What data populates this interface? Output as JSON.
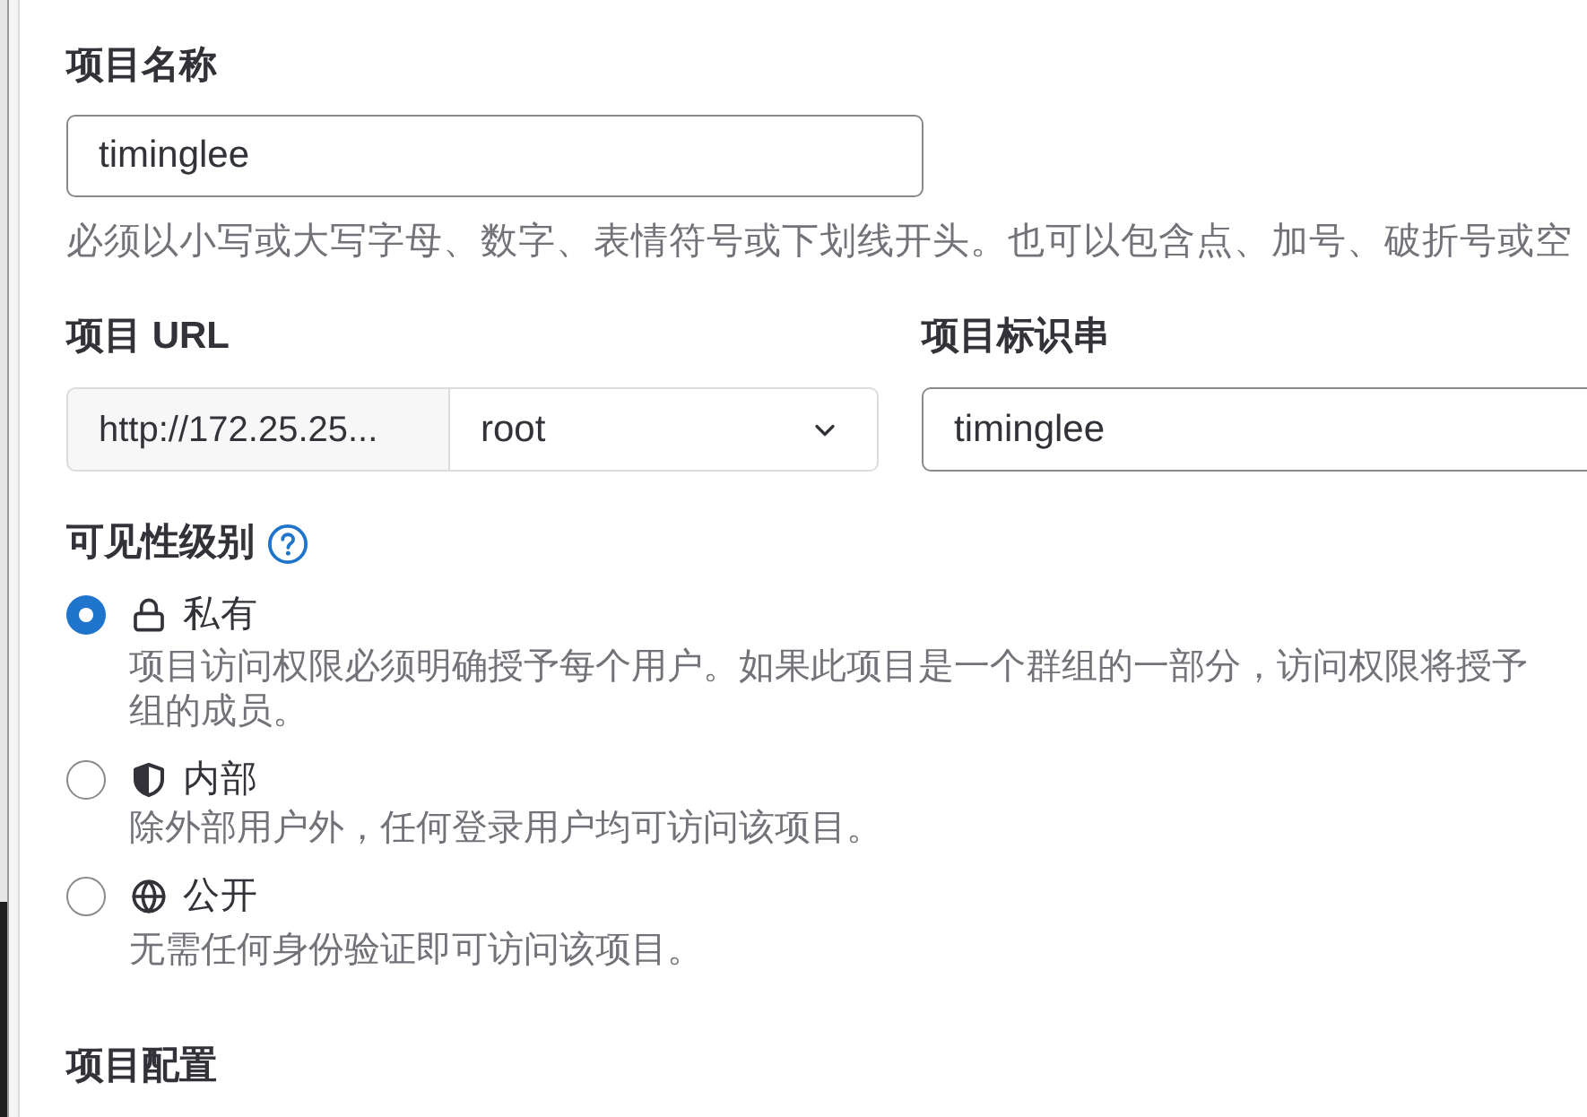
{
  "project_name": {
    "label": "项目名称",
    "value": "timinglee",
    "help": "必须以小写或大写字母、数字、表情符号或下划线开头。也可以包含点、加号、破折号或空"
  },
  "project_url": {
    "label": "项目 URL",
    "prefix": "http://172.25.25...",
    "namespace": "root"
  },
  "project_slug": {
    "label": "项目标识串",
    "value": "timinglee"
  },
  "visibility": {
    "label": "可见性级别",
    "options": [
      {
        "kind": "lock",
        "label": "私有",
        "selected": true,
        "description": [
          "项目访问权限必须明确授予每个用户。如果此项目是一个群组的一部分，访问权限将授予",
          "组的成员。"
        ]
      },
      {
        "kind": "shield",
        "label": "内部",
        "selected": false,
        "description": [
          "除外部用户外，任何登录用户均可访问该项目。"
        ]
      },
      {
        "kind": "globe",
        "label": "公开",
        "selected": false,
        "description": [
          "无需任何身份验证即可访问该项目。"
        ]
      }
    ]
  },
  "project_config": {
    "label": "项目配置"
  }
}
